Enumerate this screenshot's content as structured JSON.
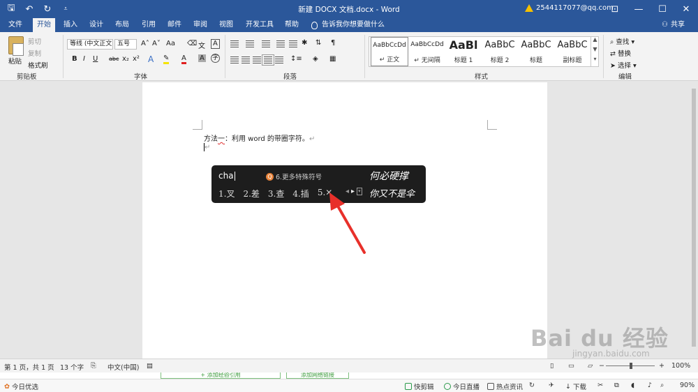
{
  "titlebar": {
    "doc_title": "新建 DOCX 文档.docx  -  Word",
    "account": "2544117077@qq.com"
  },
  "tabs": [
    "文件",
    "开始",
    "插入",
    "设计",
    "布局",
    "引用",
    "邮件",
    "审阅",
    "视图",
    "开发工具",
    "帮助"
  ],
  "tellme": "告诉我你想要做什么",
  "share": "共享",
  "ribbon": {
    "clipboard": {
      "paste": "粘贴",
      "cut": "剪切",
      "copy": "复制",
      "format_painter": "格式刷",
      "label": "剪贴板"
    },
    "font": {
      "name": "等线 (中文正文)",
      "size": "五号",
      "label": "字体",
      "aa": "Aa",
      "bold": "B",
      "italic": "I",
      "underline": "U",
      "strike": "abc",
      "sub": "x₂",
      "sup": "x²"
    },
    "paragraph": {
      "label": "段落"
    },
    "styles": {
      "label": "样式",
      "items": [
        {
          "sample": "AaBbCcDd",
          "name": "↵ 正文"
        },
        {
          "sample": "AaBbCcDd",
          "name": "↵ 无间隔"
        },
        {
          "sample": "AaBl",
          "name": "标题 1"
        },
        {
          "sample": "AaBbC",
          "name": "标题 2"
        },
        {
          "sample": "AaBbC",
          "name": "标题"
        },
        {
          "sample": "AaBbC",
          "name": "副标题"
        }
      ]
    },
    "editing": {
      "find": "查找",
      "replace": "替换",
      "select": "选择",
      "label": "编辑"
    }
  },
  "document": {
    "line1_prefix": "方法",
    "line1_wavy": "一",
    "line1_rest": "：利用 word 的带圈字符。",
    "para_mark": "↵"
  },
  "ime": {
    "composition": "cha",
    "tip_icon": "Q",
    "tip": "6.更多特殊符号",
    "candidates": [
      "1.叉",
      "2.差",
      "3.查",
      "4.插",
      "5."
    ],
    "slogan_top": "何必硬撑",
    "slogan_bottom": "你又不是伞"
  },
  "statusbar": {
    "page": "第 1 页，共 1 页",
    "words": "13 个字",
    "language": "中文(中国)",
    "zoom": "100%"
  },
  "greenstrip": {
    "tab1": "+ 添加经验引用",
    "tab2": "添加网络链接"
  },
  "taskbar": {
    "left": "今日优选",
    "items": [
      "快剪辑",
      "今日直播",
      "热点资讯",
      "下载",
      "90%"
    ]
  },
  "watermark": {
    "brand": "Bai du 经验",
    "url": "jingyan.baidu.com"
  }
}
